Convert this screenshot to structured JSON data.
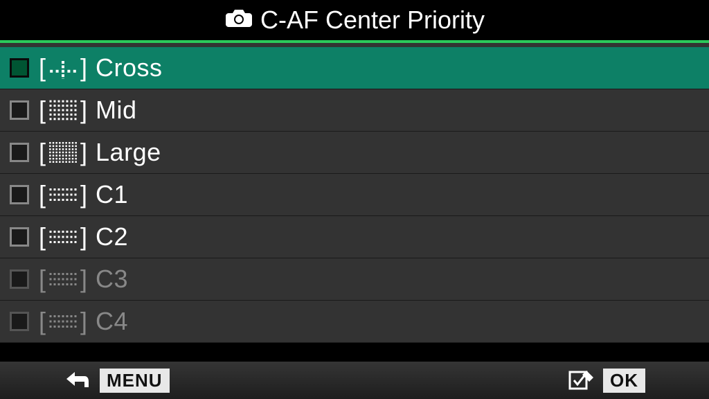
{
  "header": {
    "title": "C-AF Center Priority"
  },
  "menu": {
    "items": [
      {
        "label": "Cross",
        "pattern": "cross",
        "selected": true,
        "disabled": false
      },
      {
        "label": "Mid",
        "pattern": "mid",
        "selected": false,
        "disabled": false
      },
      {
        "label": "Large",
        "pattern": "large",
        "selected": false,
        "disabled": false
      },
      {
        "label": "C1",
        "pattern": "c1",
        "selected": false,
        "disabled": false
      },
      {
        "label": "C2",
        "pattern": "c2",
        "selected": false,
        "disabled": false
      },
      {
        "label": "C3",
        "pattern": "c3",
        "selected": false,
        "disabled": true
      },
      {
        "label": "C4",
        "pattern": "c4",
        "selected": false,
        "disabled": true
      }
    ]
  },
  "footer": {
    "menu_label": "MENU",
    "ok_label": "OK"
  }
}
